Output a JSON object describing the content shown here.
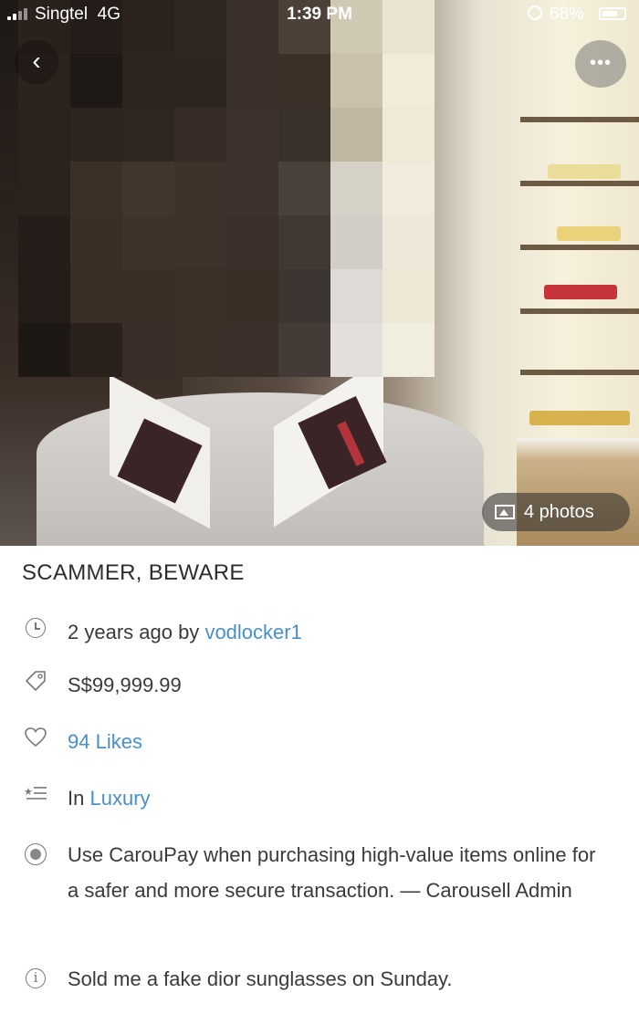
{
  "status_bar": {
    "carrier": "Singtel",
    "network": "4G",
    "time": "1:39 PM",
    "battery": "68%"
  },
  "nav": {
    "back_icon": "chevron-left-icon",
    "back_glyph": "‹",
    "more_icon": "more-dots-icon",
    "more_glyph": "•••"
  },
  "photo": {
    "count_label": "4 photos",
    "note": "blurred"
  },
  "listing": {
    "title": "SCAMMER, BEWARE",
    "posted": "2 years ago by",
    "seller": "vodlocker1",
    "price": "S$99,999.99",
    "likes": "94 Likes",
    "category_prefix": "In",
    "category": "Luxury",
    "admin_notice": "Use CarouPay when purchasing high-value items online for a safer and more secure transaction. — Carousell Admin",
    "description": "Sold me a fake dior sunglasses on Sunday."
  },
  "colors": {
    "link": "#4a8fc9",
    "text": "#3a3a3a",
    "icon": "#777777"
  }
}
